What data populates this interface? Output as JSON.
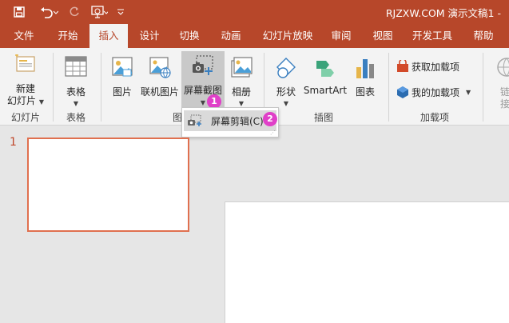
{
  "window": {
    "title": "RJZXW.COM 演示文稿1 -"
  },
  "tabs": [
    {
      "label": "文件"
    },
    {
      "label": "开始"
    },
    {
      "label": "插入"
    },
    {
      "label": "设计"
    },
    {
      "label": "切换"
    },
    {
      "label": "动画"
    },
    {
      "label": "幻灯片放映"
    },
    {
      "label": "审阅"
    },
    {
      "label": "视图"
    },
    {
      "label": "开发工具"
    },
    {
      "label": "帮助"
    }
  ],
  "active_tab": "插入",
  "ribbon": {
    "new_slide": {
      "line1": "新建",
      "line2": "幻灯片"
    },
    "table": {
      "label": "表格"
    },
    "picture": {
      "label": "图片"
    },
    "online_picture": {
      "label": "联机图片"
    },
    "screenshot": {
      "label": "屏幕截图"
    },
    "album": {
      "label": "相册"
    },
    "shapes": {
      "label": "形状"
    },
    "smartart": {
      "label": "SmartArt"
    },
    "chart": {
      "label": "图表"
    },
    "get_addins": {
      "label": "获取加载项"
    },
    "my_addins": {
      "label": "我的加载项"
    },
    "link_line1": "链",
    "link_line2": "接",
    "groups": {
      "slides": "幻灯片",
      "tables": "表格",
      "images": "图",
      "illustrations": "插图",
      "addins": "加载项"
    }
  },
  "dropdown": {
    "screen_clipping": "屏幕剪辑(C)"
  },
  "badges": {
    "one": "1",
    "two": "2"
  },
  "slides_pane": {
    "slide_number": "1"
  },
  "colors": {
    "accent": "#b7472a",
    "badge": "#e040c8",
    "thumb_border": "#e0704f"
  }
}
